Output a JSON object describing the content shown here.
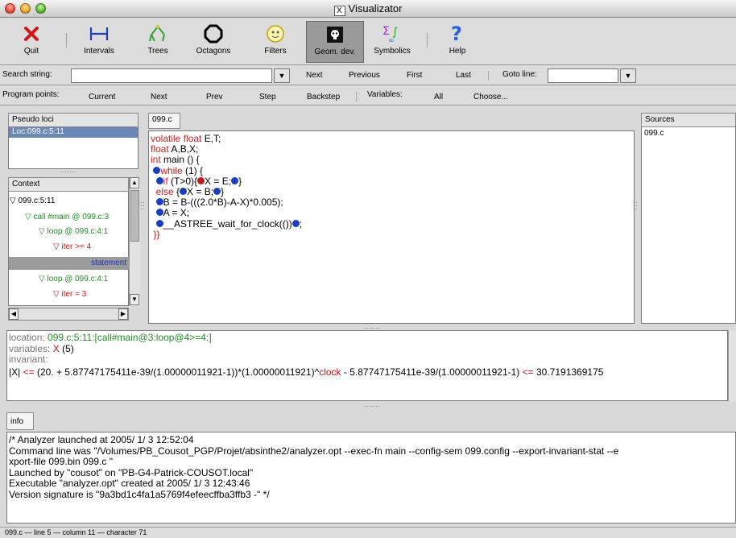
{
  "window": {
    "title": "Visualizator"
  },
  "toolbar": [
    {
      "label": "Quit",
      "icon": "quit-icon"
    },
    {
      "label": "Intervals",
      "icon": "intervals-icon"
    },
    {
      "label": "Trees",
      "icon": "trees-icon"
    },
    {
      "label": "Octagons",
      "icon": "octagons-icon"
    },
    {
      "label": "Filters",
      "icon": "filters-icon"
    },
    {
      "label": "Geom. dev.",
      "icon": "geom-dev-icon",
      "active": true
    },
    {
      "label": "Symbolics",
      "icon": "symbolics-icon"
    },
    {
      "label": "Help",
      "icon": "help-icon"
    }
  ],
  "search": {
    "label": "Search string:",
    "value": "",
    "next": "Next",
    "previous": "Previous",
    "first": "First",
    "last": "Last",
    "goto_label": "Goto line:",
    "goto_value": ""
  },
  "program_points": {
    "label": "Program points:",
    "current": "Current",
    "next": "Next",
    "prev": "Prev",
    "step": "Step",
    "backstep": "Backstep",
    "variables_label": "Variables:",
    "all": "All",
    "choose": "Choose..."
  },
  "pseudo_loci": {
    "header": "Pseudo loci",
    "items": [
      "Loc:099.c:5:11"
    ]
  },
  "context": {
    "header": "Context",
    "items": [
      {
        "text": "099.c:5:11"
      },
      {
        "text": "call #main @ 099.c:3"
      },
      {
        "text": "loop @ 099.c:4:1"
      },
      {
        "text": "iter >= 4"
      },
      {
        "text": "statement"
      },
      {
        "text": "loop @ 099.c:4:1"
      },
      {
        "text": "iter = 3"
      }
    ]
  },
  "editor": {
    "tab": "099.c",
    "lines": [
      {
        "a": "volatile float ",
        "b": "E,T;"
      },
      {
        "a": "float ",
        "b": "A,B,X;"
      },
      {
        "a": "int ",
        "b": "main () {"
      },
      {
        "a": "while",
        "b": " (1) {"
      },
      {
        "a": "if",
        "b": " (T>0){",
        "c": "X = E;",
        "d": "}"
      },
      {
        "a": "else",
        "b": " {",
        "c": "X = B;",
        "d": "}"
      },
      {
        "a": "B = B-(((2.0*B)-A-X)*0.005);"
      },
      {
        "a": "A = X;"
      },
      {
        "a": "__ASTREE_wait_for_clock(())",
        "b": ";"
      },
      {
        "a": "}}"
      }
    ]
  },
  "sources": {
    "header": "Sources",
    "items": [
      "099.c"
    ]
  },
  "invariant": {
    "location_label": "location:",
    "location_value": "099.c:5:11:[call#main@3:loop@4>=4:]",
    "variables_label": "variables:",
    "variables_x": "X",
    "variables_rest": "(5)",
    "invariant_label": "invariant:",
    "invariant_a": "|X|",
    "invariant_b": "<=",
    "invariant_c": "(20. + 5.87747175411e-39/(1.00000011921-1))*(1.00000011921)^",
    "invariant_clock": "clock",
    "invariant_d": " - 5.87747175411e-39/(1.00000011921-1)",
    "invariant_e": "<=",
    "invariant_f": "30.7191369175"
  },
  "info": {
    "tab": "info",
    "lines": [
      "/* Analyzer launched at 2005/ 1/ 3 12:52:04",
      "Command line was \"/Volumes/PB_Cousot_PGP/Projet/absinthe2/analyzer.opt --exec-fn main --config-sem 099.config --export-invariant-stat --e",
      "xport-file 099.bin 099.c \"",
      "Launched by \"cousot\" on \"PB-G4-Patrick-COUSOT.local\"",
      "Executable \"analyzer.opt\" created at 2005/ 1/ 3 12:43:46",
      "Version signature is \"9a3bd1c4fa1a5769f4efeecffba3ffb3 -\" */"
    ]
  },
  "status": {
    "text": "099.c — line 5 — column 11 — character 71"
  },
  "colors": {
    "accent": "#1a3ec2",
    "keyword": "#cc2222",
    "context_green": "#1f8f1f"
  }
}
